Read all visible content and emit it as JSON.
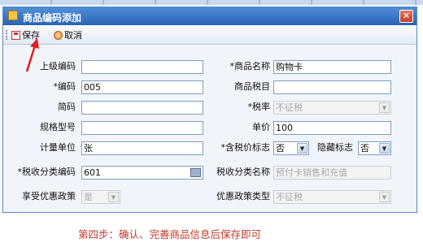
{
  "window": {
    "title": "商品编码添加",
    "close_glyph": "✕"
  },
  "toolbar": {
    "save_label": "保存",
    "cancel_label": "取消"
  },
  "form": {
    "superior_code": {
      "label": "上级编码",
      "value": ""
    },
    "product_name": {
      "label": "*商品名称",
      "value": "购物卡"
    },
    "code": {
      "label": "*编码",
      "value": "005"
    },
    "tax_item": {
      "label": "商品税目",
      "value": ""
    },
    "short_code": {
      "label": "简码",
      "value": ""
    },
    "tax_rate": {
      "label": "*税率",
      "value": "不征税"
    },
    "spec_model": {
      "label": "规格型号",
      "value": ""
    },
    "unit_price": {
      "label": "单价",
      "value": "100"
    },
    "unit": {
      "label": "计量单位",
      "value": "张"
    },
    "tax_included_flag": {
      "label": "*含税价标志",
      "value": "否"
    },
    "hidden_flag": {
      "label": "隐藏标志",
      "value": "否"
    },
    "tax_class_code": {
      "label": "*税收分类编码",
      "value": "601"
    },
    "tax_class_name": {
      "label": "税收分类名称",
      "value": "预付卡销售和充值"
    },
    "preferential_enjoy": {
      "label": "享受优惠政策",
      "value": "是"
    },
    "preferential_type": {
      "label": "优惠政策类型",
      "value": "不征税"
    }
  },
  "caption": "第四步：确认、完善商品信息后保存即可",
  "colors": {
    "titlebar": "#2a62b3",
    "caption": "#c0392b",
    "arrow": "#e02020"
  }
}
